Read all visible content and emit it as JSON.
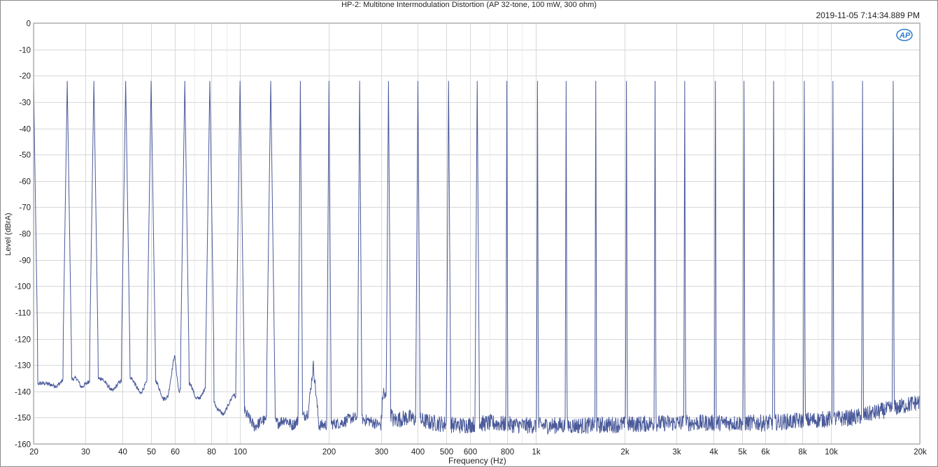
{
  "chart_data": {
    "type": "line",
    "title": "HP-2: Multitone Intermodulation Distortion (AP 32-tone, 100 mW, 300 ohm)",
    "timestamp": "2019-11-05 7:14:34.889 PM",
    "logo_text": "AP",
    "xlabel": "Frequency (Hz)",
    "ylabel": "Level (dBrA)",
    "x_scale": "log",
    "xlim": [
      20,
      20000
    ],
    "ylim": [
      -160,
      0
    ],
    "grid": true,
    "x_ticks": [
      {
        "value": 20,
        "label": "20"
      },
      {
        "value": 30,
        "label": "30"
      },
      {
        "value": 40,
        "label": "40"
      },
      {
        "value": 50,
        "label": "50"
      },
      {
        "value": 60,
        "label": "60"
      },
      {
        "value": 80,
        "label": "80"
      },
      {
        "value": 100,
        "label": "100"
      },
      {
        "value": 200,
        "label": "200"
      },
      {
        "value": 300,
        "label": "300"
      },
      {
        "value": 400,
        "label": "400"
      },
      {
        "value": 500,
        "label": "500"
      },
      {
        "value": 600,
        "label": "600"
      },
      {
        "value": 800,
        "label": "800"
      },
      {
        "value": 1000,
        "label": "1k"
      },
      {
        "value": 2000,
        "label": "2k"
      },
      {
        "value": 3000,
        "label": "3k"
      },
      {
        "value": 4000,
        "label": "4k"
      },
      {
        "value": 5000,
        "label": "5k"
      },
      {
        "value": 6000,
        "label": "6k"
      },
      {
        "value": 8000,
        "label": "8k"
      },
      {
        "value": 10000,
        "label": "10k"
      },
      {
        "value": 20000,
        "label": "20k"
      }
    ],
    "y_ticks": [
      0,
      -10,
      -20,
      -30,
      -40,
      -50,
      -60,
      -70,
      -80,
      -90,
      -100,
      -110,
      -120,
      -130,
      -140,
      -150,
      -160
    ],
    "series": [
      {
        "color": "#4a5a9a",
        "tone_level": -22,
        "tones": [
          20,
          26,
          32,
          41,
          50,
          65,
          79,
          100,
          127,
          160,
          200,
          254,
          318,
          400,
          508,
          635,
          800,
          1016,
          1270,
          1600,
          2032,
          2540,
          3200,
          4064,
          5080,
          6400,
          8128,
          10160,
          12800,
          16256
        ],
        "floor": [
          [
            22,
            -137
          ],
          [
            24,
            -138
          ],
          [
            25,
            -136
          ],
          [
            28,
            -135
          ],
          [
            29,
            -138.5
          ],
          [
            31,
            -136
          ],
          [
            34,
            -135
          ],
          [
            37,
            -140
          ],
          [
            39,
            -136.5
          ],
          [
            43,
            -135
          ],
          [
            46,
            -141
          ],
          [
            48,
            -137
          ],
          [
            52,
            -136
          ],
          [
            55,
            -143
          ],
          [
            57,
            -142
          ],
          [
            60,
            -126
          ],
          [
            62,
            -140
          ],
          [
            68,
            -137
          ],
          [
            71,
            -143
          ],
          [
            74,
            -142
          ],
          [
            77,
            -137
          ],
          [
            83,
            -146
          ],
          [
            88,
            -149
          ],
          [
            95,
            -141
          ],
          [
            107,
            -150
          ],
          [
            112,
            -153.5
          ],
          [
            119,
            -151
          ],
          [
            135,
            -152
          ],
          [
            142,
            -150.5
          ],
          [
            150,
            -153
          ],
          [
            170,
            -148
          ],
          [
            177,
            -130
          ],
          [
            185,
            -153
          ],
          [
            220,
            -152
          ],
          [
            240,
            -150
          ],
          [
            270,
            -151
          ],
          [
            300,
            -153
          ],
          [
            305,
            -140
          ],
          [
            330,
            -151
          ],
          [
            370,
            -150
          ],
          [
            450,
            -152
          ],
          [
            550,
            -153
          ],
          [
            700,
            -152
          ],
          [
            900,
            -153
          ],
          [
            1500,
            -153
          ],
          [
            3000,
            -152
          ],
          [
            6000,
            -152
          ],
          [
            12000,
            -150
          ],
          [
            20000,
            -144
          ]
        ]
      }
    ]
  }
}
